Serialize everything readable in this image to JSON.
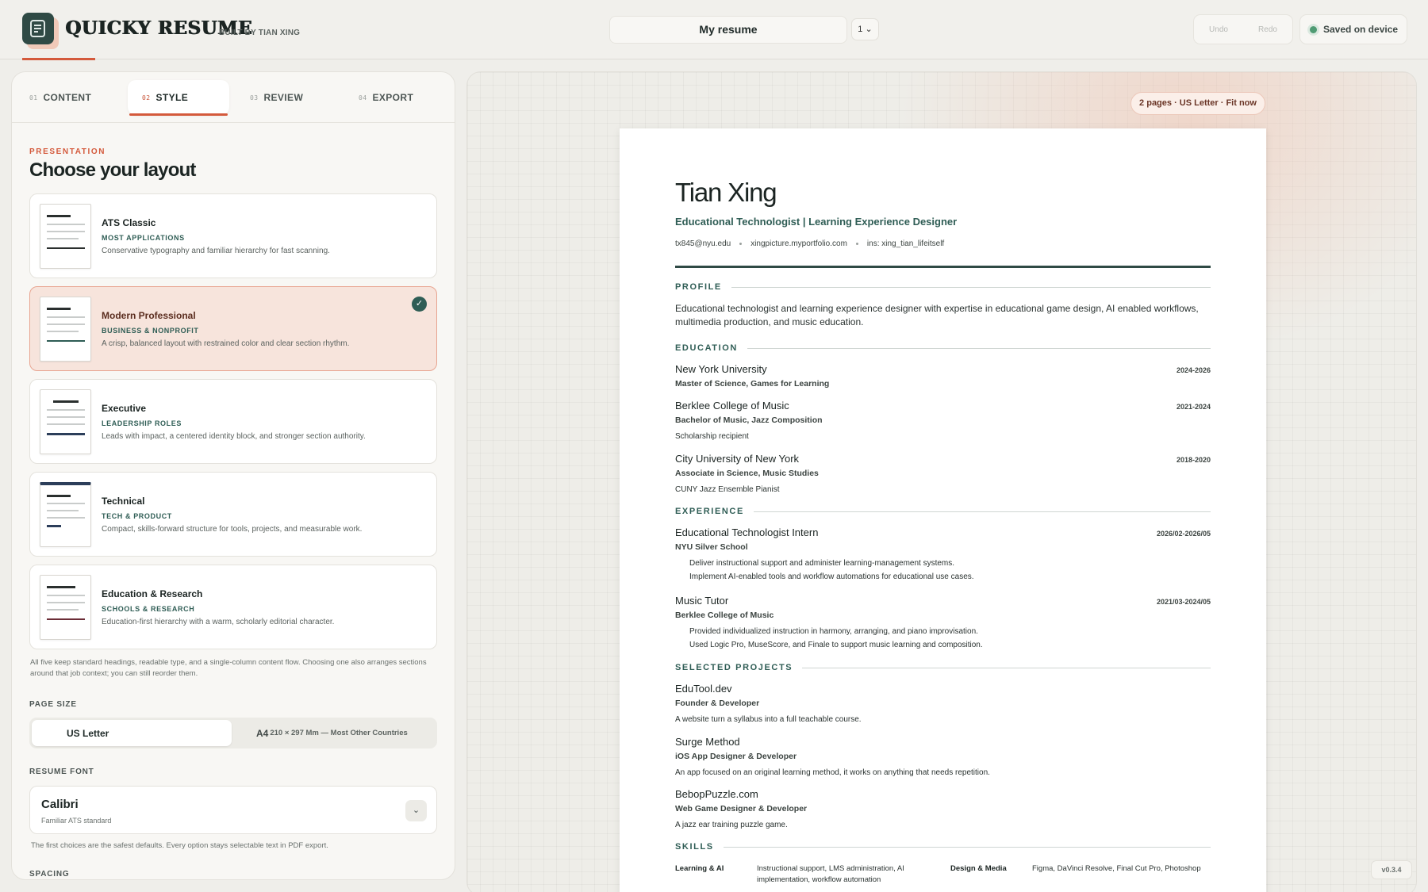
{
  "header": {
    "brand": "QUICKY RESUME",
    "brand_sub": "BUILT BY TIAN XING",
    "doc_title": "My resume",
    "page_count": "1 ⌄",
    "undo": "Undo",
    "redo": "Redo",
    "saved": "Saved on device"
  },
  "tabs": [
    {
      "num": "01",
      "label": "CONTENT"
    },
    {
      "num": "02",
      "label": "STYLE"
    },
    {
      "num": "03",
      "label": "REVIEW"
    },
    {
      "num": "04",
      "label": "EXPORT"
    }
  ],
  "style_panel": {
    "eyebrow": "PRESENTATION",
    "title": "Choose your layout",
    "layouts": [
      {
        "name": "ATS Classic",
        "tag": "MOST APPLICATIONS",
        "desc": "Conservative typography and familiar hierarchy for fast scanning.",
        "selected": false
      },
      {
        "name": "Modern Professional",
        "tag": "BUSINESS & NONPROFIT",
        "desc": "A crisp, balanced layout with restrained color and clear section rhythm.",
        "selected": true
      },
      {
        "name": "Executive",
        "tag": "LEADERSHIP ROLES",
        "desc": "Leads with impact, a centered identity block, and stronger section authority.",
        "selected": false
      },
      {
        "name": "Technical",
        "tag": "TECH & PRODUCT",
        "desc": "Compact, skills-forward structure for tools, projects, and measurable work.",
        "selected": false
      },
      {
        "name": "Education & Research",
        "tag": "SCHOOLS & RESEARCH",
        "desc": "Education-first hierarchy with a warm, scholarly editorial character.",
        "selected": false
      }
    ],
    "note": "All five keep standard headings, readable type, and a single-column content flow. Choosing one also arranges sections around that job context; you can still reorder them.",
    "page_size_label": "PAGE SIZE",
    "page_size_selected": "US Letter",
    "page_size_alt_big": "A4",
    "page_size_alt_small": "210 × 297 Mm — Most Other Countries",
    "font_label": "RESUME FONT",
    "font_name": "Calibri",
    "font_sub": "Familiar ATS standard",
    "font_caret": "⌄",
    "font_note": "The first choices are the safest defaults. Every option stays selectable text in PDF export.",
    "spacing_label": "SPACING"
  },
  "preview": {
    "fit_pill": "2 pages · US Letter · Fit now",
    "version": "v0.3.4"
  },
  "resume": {
    "name": "Tian Xing",
    "headline": "Educational Technologist | Learning Experience Designer",
    "contact": [
      "tx845@nyu.edu",
      "xingpicture.myportfolio.com",
      "ins: xing_tian_lifeitself"
    ],
    "profile_title": "PROFILE",
    "profile": "Educational technologist and learning experience designer with expertise in educational game design, AI enabled workflows, multimedia production, and music education.",
    "education_title": "EDUCATION",
    "education": [
      {
        "school": "New York University",
        "degree": "Master of Science, Games for Learning",
        "dates": "2024-2026",
        "note": ""
      },
      {
        "school": "Berklee College of Music",
        "degree": "Bachelor of Music, Jazz Composition",
        "dates": "2021-2024",
        "note": "Scholarship recipient"
      },
      {
        "school": "City University of New York",
        "degree": "Associate in Science, Music Studies",
        "dates": "2018-2020",
        "note": "CUNY Jazz Ensemble Pianist"
      }
    ],
    "experience_title": "EXPERIENCE",
    "experience": [
      {
        "role": "Educational Technologist Intern",
        "org": "NYU Silver School",
        "dates": "2026/02-2026/05",
        "bullets": [
          "Deliver instructional support and administer learning-management systems.",
          "Implement AI-enabled tools and workflow automations for educational use cases."
        ]
      },
      {
        "role": "Music Tutor",
        "org": "Berklee College of Music",
        "dates": "2021/03-2024/05",
        "bullets": [
          "Provided individualized instruction in harmony, arranging, and piano improvisation.",
          "Used Logic Pro, MuseScore, and Finale to support music learning and composition."
        ]
      }
    ],
    "projects_title": "SELECTED PROJECTS",
    "projects": [
      {
        "name": "EduTool.dev",
        "role": "Founder & Developer",
        "desc": "A website turn a syllabus into a full teachable course."
      },
      {
        "name": "Surge Method",
        "role": "iOS App Designer & Developer",
        "desc": "An app focused on an original learning method, it works on anything that needs repetition."
      },
      {
        "name": "BebopPuzzle.com",
        "role": "Web Game Designer & Developer",
        "desc": "A jazz ear training puzzle game."
      }
    ],
    "skills_title": "SKILLS",
    "skills": [
      {
        "cat": "Learning & AI",
        "val": "Instructional support, LMS administration, AI implementation, workflow automation"
      },
      {
        "cat": "Design & Media",
        "val": "Figma, DaVinci Resolve, Final Cut Pro, Photoshop"
      }
    ]
  },
  "colors": {
    "accent": "#d45a3c",
    "brand_green": "#2f5d55",
    "selected_card": "#f7e4dc"
  },
  "icons": {
    "logo": "document-icon",
    "check": "check-icon",
    "caret": "chevron-down-icon"
  }
}
